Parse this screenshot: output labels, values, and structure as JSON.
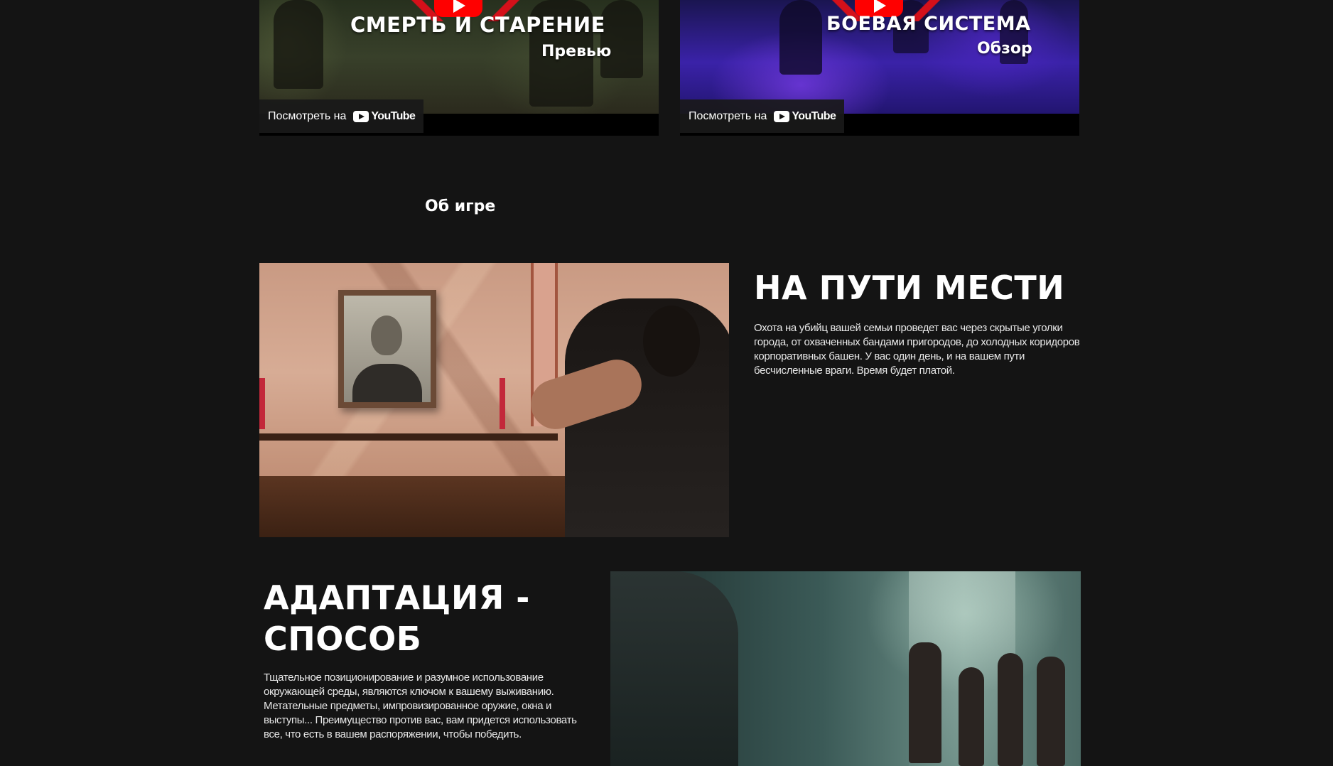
{
  "videos": [
    {
      "title": "СМЕРТЬ И СТАРЕНИЕ",
      "subtitle": "Превью",
      "watch_label": "Посмотреть на",
      "platform": "YouTube"
    },
    {
      "title": "БОЕВАЯ СИСТЕМА",
      "subtitle": "Обзор",
      "watch_label": "Посмотреть на",
      "platform": "YouTube"
    }
  ],
  "section": {
    "heading": "Об игре"
  },
  "features": [
    {
      "title": "НА ПУТИ МЕСТИ",
      "description": "Охота на убийц вашей семьи проведет вас через скрытые уголки города, от охваченных бандами пригородов, до холодных коридоров корпоративных башен. У вас один день, и на вашем пути бесчисленные враги. Время будет платой."
    },
    {
      "title": "АДАПТАЦИЯ - СПОСОБ",
      "description": "Тщательное позиционирование и разумное использование окружающей среды, являются ключом к вашему выживанию. Метательные предметы, импровизированное оружие, окна и выступы... Преимущество против вас, вам придется использовать все, что есть в вашем распоряжении, чтобы победить."
    }
  ],
  "colors": {
    "background": "#141414",
    "text": "#ffffff",
    "youtube_red": "#ff0000",
    "accent_red": "#d4101a"
  },
  "icons": [
    "youtube-play-icon",
    "youtube-logo-icon"
  ]
}
